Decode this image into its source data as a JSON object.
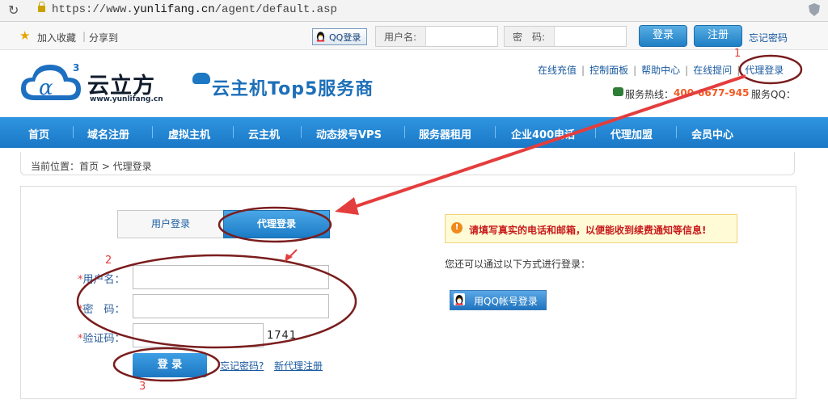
{
  "browser": {
    "url_prefix": "https://www.",
    "url_host": "yunlifang.cn",
    "url_path": "/agent/default.asp"
  },
  "topbar": {
    "favorite": "加入收藏",
    "divider": "|",
    "share": "分享到",
    "qq_login": "QQ登录",
    "username_label": "用户名:",
    "password_label": "密　码:",
    "login": "登录",
    "register": "注册",
    "forgot": "忘记密码"
  },
  "header": {
    "logo_text": "云立方",
    "logo_domain": "www.yunlifang.cn",
    "slogan": "云主机Top5服务商",
    "links": [
      "在线充值",
      "控制面板",
      "帮助中心",
      "在线提问",
      "代理登录"
    ],
    "link_separator": "|",
    "hotline_label": "服务热线：",
    "hotline_number": "400-6677-945",
    "qq_service": "服务QQ："
  },
  "nav": [
    "首页",
    "域名注册",
    "虚拟主机",
    "云主机",
    "动态拨号VPS",
    "服务器租用",
    "企业400电话",
    "代理加盟",
    "会员中心"
  ],
  "breadcrumb": {
    "label": "当前位置：首页 > 代理登录"
  },
  "login": {
    "tab_user": "用户登录",
    "tab_agent": "代理登录",
    "required": "*",
    "username_label": "用户名：",
    "password_label": "密　码：",
    "captcha_label": "验证码：",
    "captcha_text": "1741",
    "submit": "登 录",
    "forgot": "忘记密码?",
    "new_agent": "新代理注册"
  },
  "side": {
    "notice": "请填写真实的电话和邮箱，以便能收到续费通知等信息!",
    "alt_text": "您还可以通过以下方式进行登录：",
    "qq_login": "用QQ帐号登录"
  },
  "annotations": {
    "step1": "1",
    "step2": "2",
    "step3": "3"
  },
  "colors": {
    "nav_blue": "#1a78c7",
    "annotation_red": "#e43d3d",
    "ellipse": "#7a1d1d",
    "hotline": "#f15a23"
  }
}
